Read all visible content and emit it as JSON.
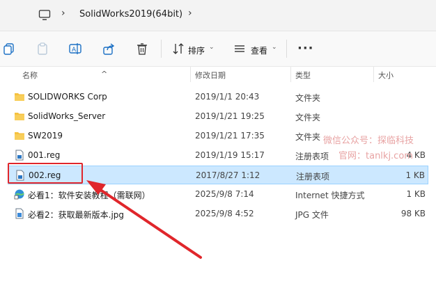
{
  "address": {
    "breadcrumb": "SolidWorks2019(64bit)"
  },
  "toolbar": {
    "sort_label": "排序",
    "view_label": "查看",
    "more_label": "···"
  },
  "columns": {
    "name": "名称",
    "modified": "修改日期",
    "type": "类型",
    "size": "大小"
  },
  "files": [
    {
      "name": "SOLIDWORKS Corp",
      "modified": "2019/1/1 20:43",
      "type": "文件夹",
      "size": "",
      "icon": "folder-icon"
    },
    {
      "name": "SolidWorks_Server",
      "modified": "2019/1/21 19:25",
      "type": "文件夹",
      "size": "",
      "icon": "folder-icon"
    },
    {
      "name": "SW2019",
      "modified": "2019/1/21 17:35",
      "type": "文件夹",
      "size": "",
      "icon": "folder-icon"
    },
    {
      "name": "001.reg",
      "modified": "2019/1/19 15:17",
      "type": "注册表项",
      "size": "4 KB",
      "icon": "registry-file-icon"
    },
    {
      "name": "002.reg",
      "modified": "2017/8/27 1:12",
      "type": "注册表项",
      "size": "1 KB",
      "icon": "registry-file-icon",
      "selected": true
    },
    {
      "name": "必看1：软件安装教程（需联网）",
      "modified": "2025/9/8 7:14",
      "type": "Internet 快捷方式",
      "size": "1 KB",
      "icon": "internet-shortcut-icon"
    },
    {
      "name": "必看2：获取最新版本.jpg",
      "modified": "2025/9/8 4:52",
      "type": "JPG 文件",
      "size": "98 KB",
      "icon": "image-file-icon"
    }
  ],
  "watermark": {
    "line1": "微信公众号：探临科技",
    "line2": "官网：tanlkj.com"
  },
  "colors": {
    "selection": "#cce8ff",
    "highlight": "#e0262b",
    "folder": "#f5c13f"
  }
}
